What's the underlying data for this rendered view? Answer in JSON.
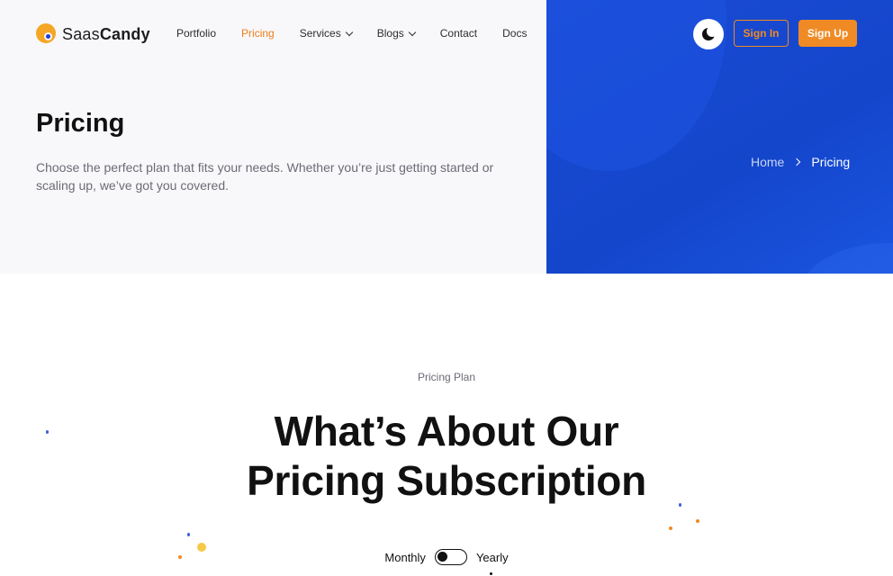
{
  "brand": {
    "name_light": "Saas",
    "name_bold": "Candy"
  },
  "nav": {
    "items": [
      {
        "label": "Portfolio",
        "active": false,
        "dropdown": false
      },
      {
        "label": "Pricing",
        "active": true,
        "dropdown": false
      },
      {
        "label": "Services",
        "active": false,
        "dropdown": true
      },
      {
        "label": "Blogs",
        "active": false,
        "dropdown": true
      },
      {
        "label": "Contact",
        "active": false,
        "dropdown": false
      },
      {
        "label": "Docs",
        "active": false,
        "dropdown": false
      }
    ],
    "theme_icon": "moon-icon",
    "signin_label": "Sign In",
    "signup_label": "Sign Up"
  },
  "hero": {
    "title": "Pricing",
    "description": "Choose the perfect plan that fits your needs. Whether you’re just getting started or scaling up, we’ve got you covered.",
    "breadcrumb": {
      "home": "Home",
      "current": "Pricing"
    }
  },
  "pricing": {
    "eyebrow": "Pricing Plan",
    "title_line1": "What’s About Our",
    "title_line2": "Pricing Subscription",
    "toggle": {
      "monthly_label": "Monthly",
      "yearly_label": "Yearly",
      "selected": "Monthly"
    }
  },
  "colors": {
    "accent": "#f08a24",
    "hero_blue": "#1446cc",
    "hero_light": "#f8f8fa"
  }
}
